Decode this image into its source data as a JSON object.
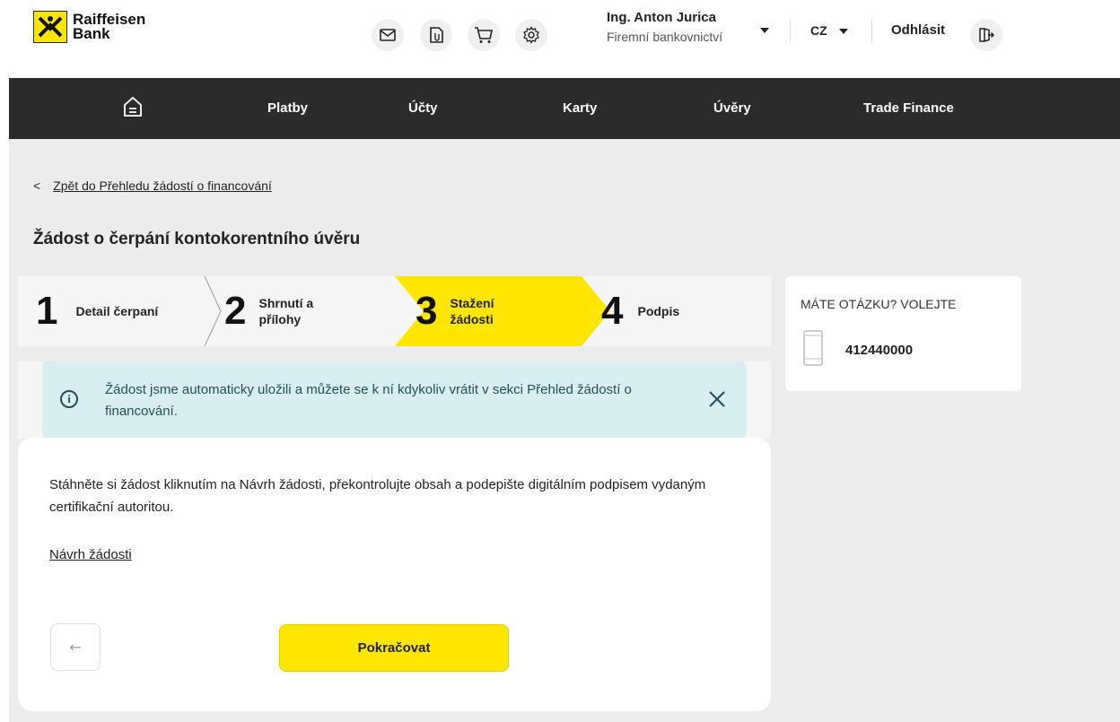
{
  "brand": {
    "name_line1": "Raiffeisen",
    "name_line2": "Bank",
    "accent": "#fee600",
    "dark": "#2b2b2b",
    "info_bg": "#d9eef0"
  },
  "header": {
    "icons": [
      "mail-icon",
      "documents-icon",
      "cart-icon",
      "settings-icon"
    ],
    "user_name": "Ing. Anton Jurica",
    "user_role": "Firemní bankovnictví",
    "language": "CZ",
    "logout_label": "Odhlásit"
  },
  "nav": {
    "items": [
      {
        "label": "Platby"
      },
      {
        "label": "Účty"
      },
      {
        "label": "Karty"
      },
      {
        "label": "Úvěry"
      },
      {
        "label": "Trade Finance"
      }
    ]
  },
  "breadcrumb": {
    "back_label": "Zpět do Přehledu žádostí o financování"
  },
  "page": {
    "title": "Žádost o čerpání kontokorentního úvěru"
  },
  "stepper": {
    "active_step": 3,
    "steps": [
      {
        "number": "1",
        "label": "Detail čerpaní"
      },
      {
        "number": "2",
        "label": "Shrnutí a přílohy"
      },
      {
        "number": "3",
        "label": "Stažení žádosti"
      },
      {
        "number": "4",
        "label": "Podpis"
      }
    ]
  },
  "info_banner": {
    "text": "Žádost jsme automaticky uložili a můžete se k ní kdykoliv vrátit v sekci  Přehled žádostí o financování."
  },
  "card": {
    "text": "Stáhněte si žádost kliknutím na Návrh žádosti, překontrolujte obsah a podepište digitálním podpisem vydaným certifikační autoritou.",
    "link_label": "Návrh žádosti",
    "back_button_symbol": "←",
    "continue_label": "Pokračovat"
  },
  "contact": {
    "title": "MÁTE OTÁZKU? VOLEJTE",
    "phone": "412440000"
  }
}
